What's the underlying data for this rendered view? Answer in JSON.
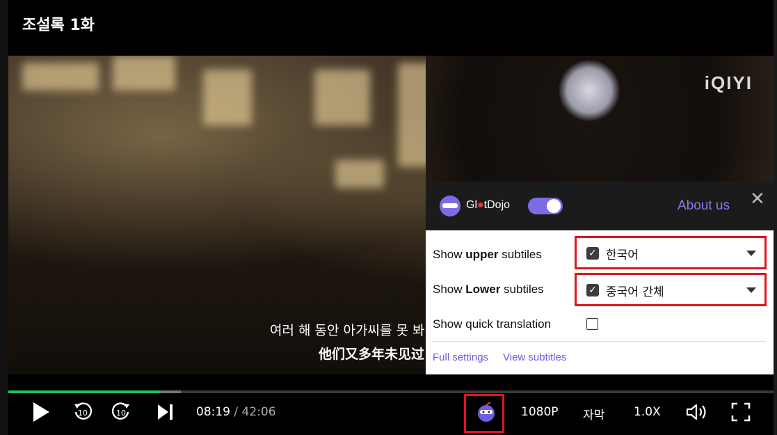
{
  "header": {
    "title": "조설록 1화"
  },
  "video": {
    "watermark": "iQIYI",
    "subtitle_upper": "여러 해 동안 아가씨를 못 봐",
    "subtitle_lower": "他们又多年未见过"
  },
  "player": {
    "progress_played": 0.198,
    "progress_buffered": 0.225,
    "current_time": "08:19",
    "separator": "/",
    "duration": "42:06",
    "quality": "1080P",
    "subtitle_button": "자막",
    "speed": "1.0X"
  },
  "panel": {
    "brand_prefix": "Gl",
    "brand_dot": "●",
    "brand_suffix": "tDojo",
    "about_label": "About us",
    "close_glyph": "✕",
    "rows": [
      {
        "prefix": "Show ",
        "bold": "upper",
        "suffix": " subtiles",
        "value": "한국어",
        "checked": true
      },
      {
        "prefix": "Show ",
        "bold": "Lower",
        "suffix": " subtiles",
        "value": "중국어 간체",
        "checked": true
      }
    ],
    "quick_translation_label": "Show quick translation",
    "full_settings": "Full settings",
    "view_subtitles": "View subtitles"
  },
  "colors": {
    "accent": "#7b6ce6",
    "progress": "#21c35a",
    "highlight": "#e0141c"
  }
}
